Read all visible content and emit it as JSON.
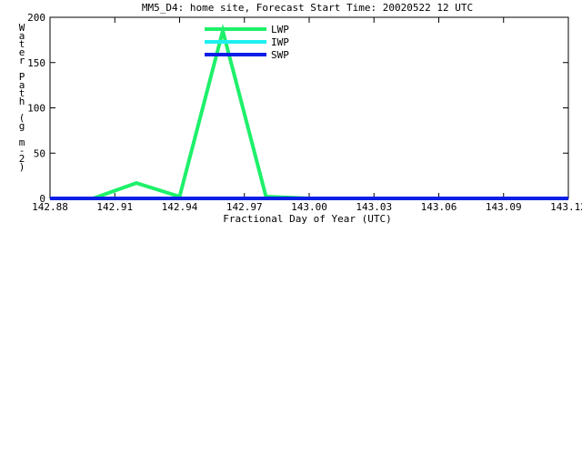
{
  "chart_data": {
    "type": "line",
    "title": "MM5_D4: home site,  Forecast Start Time: 20020522 12 UTC",
    "xlabel": "Fractional Day of Year (UTC)",
    "ylabel_chars": [
      "W",
      "a",
      "t",
      "e",
      "r",
      " ",
      "P",
      "a",
      "t",
      "h",
      " ",
      "(",
      "g",
      " ",
      "m",
      "-",
      "2",
      ")"
    ],
    "xlim": [
      142.88,
      143.12
    ],
    "ylim": [
      0,
      200
    ],
    "x_ticks": [
      142.88,
      142.91,
      142.94,
      142.97,
      143.0,
      143.03,
      143.06,
      143.09,
      143.12
    ],
    "x_tick_labels": [
      "142.88",
      "142.91",
      "142.94",
      "142.97",
      "143.00",
      "143.03",
      "143.06",
      "143.09",
      "143.12"
    ],
    "y_ticks": [
      0,
      50,
      100,
      150,
      200
    ],
    "y_tick_labels": [
      "0",
      "50",
      "100",
      "150",
      "200"
    ],
    "legend_position": "top-center",
    "series": [
      {
        "name": "LWP",
        "color": "#1ef06a",
        "x": [
          142.88,
          142.9,
          142.92,
          142.94,
          142.96,
          142.98,
          143.0,
          143.12
        ],
        "y": [
          0,
          0,
          17,
          2,
          185,
          2,
          0,
          0
        ]
      },
      {
        "name": "IWP",
        "color": "#1ef0f0",
        "x": [
          142.88,
          143.12
        ],
        "y": [
          0,
          0
        ]
      },
      {
        "name": "SWP",
        "color": "#0a1ee6",
        "x": [
          142.88,
          143.12
        ],
        "y": [
          0,
          0
        ]
      }
    ]
  }
}
